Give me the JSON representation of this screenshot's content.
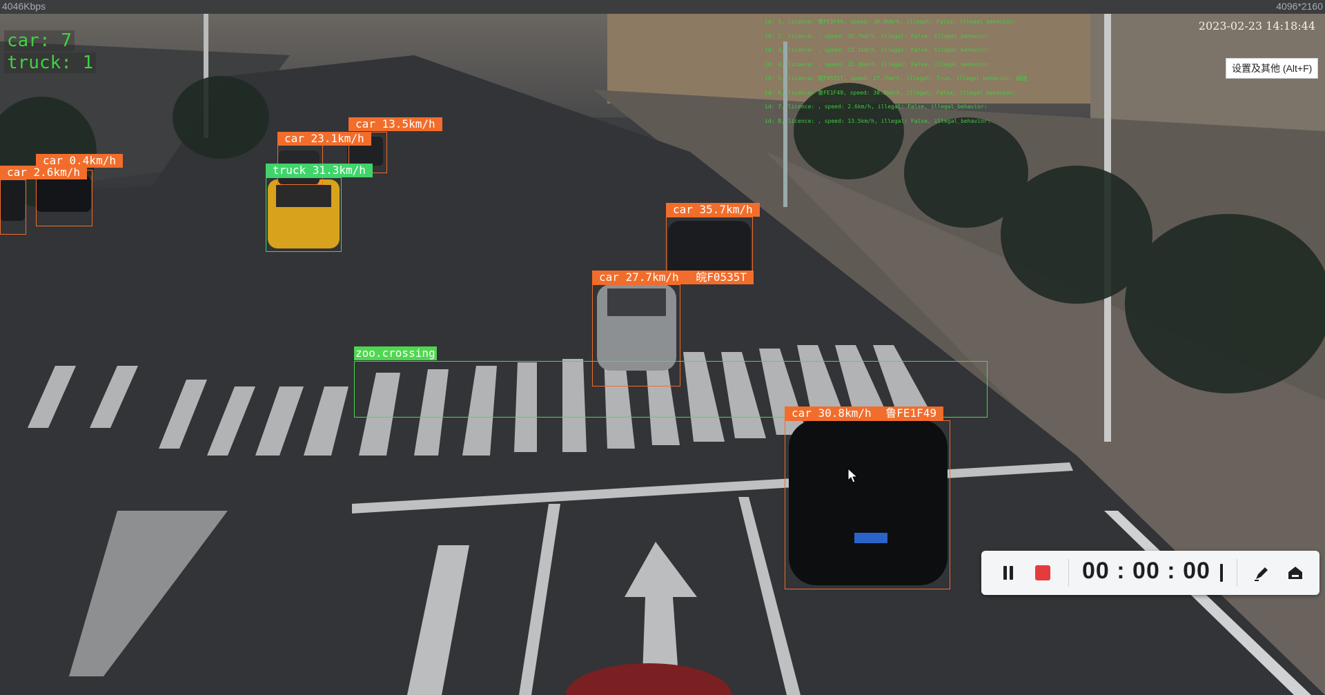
{
  "statusbar": {
    "bitrate": "4046Kbps",
    "resolution": "4096*2160"
  },
  "overlay": {
    "timestamp": "2023-02-23 14:18:44",
    "counts": {
      "car": "car: 7",
      "truck": "truck: 1"
    },
    "tooltip": "设置及其他 (Alt+F)",
    "log_lines": [
      "id: 1, licence: 鲁FE1F49, speed: 30.8km/h, illegal: False, illegal_behavior:",
      "id: 2, licence: , speed: 35.7km/h, illegal: False, illegal_behavior:",
      "id: 3, licence: , speed: 23.1km/h, illegal: False, illegal_behavior:",
      "id: 4, licence: , speed: 31.3km/h, illegal: False, illegal_behavior:",
      "id: 5, licence: 皖F0535T, speed: 27.7km/h, illegal: True, illegal_behavior: 越线",
      "id: 6, licence: 鲁FE1F49, speed: 30.8km/h, illegal: False, illegal_behavior:",
      "id: 7, licence: , speed: 2.6km/h, illegal: False, illegal_behavior:",
      "id: 8, licence: , speed: 13.5km/h, illegal: False, illegal_behavior:"
    ]
  },
  "detections": [
    {
      "label": "car 13.5km/h",
      "kind": "car"
    },
    {
      "label": "car 23.1km/h",
      "kind": "car"
    },
    {
      "label": "truck 31.3km/h",
      "kind": "truck"
    },
    {
      "label": "car 0.4km/h",
      "kind": "car"
    },
    {
      "label": "car 2.6km/h",
      "kind": "car"
    },
    {
      "label": "car 35.7km/h",
      "kind": "car"
    },
    {
      "label": "car 27.7km/h",
      "plate": "皖F0535T",
      "kind": "car"
    },
    {
      "label": "car 30.8km/h",
      "plate": "鲁FE1F49",
      "kind": "car"
    }
  ],
  "zone": {
    "label": "zoo.crossing"
  },
  "toolbar": {
    "timer": "00 : 00 : 00",
    "pause_icon": "pause-icon",
    "stop_icon": "stop-icon",
    "pen_icon": "pen-icon",
    "home_icon": "home-icon"
  },
  "colors": {
    "car": "#f26d2b",
    "truck": "#3fd56a",
    "zone": "#4fd84f",
    "stop": "#e53b3b"
  }
}
